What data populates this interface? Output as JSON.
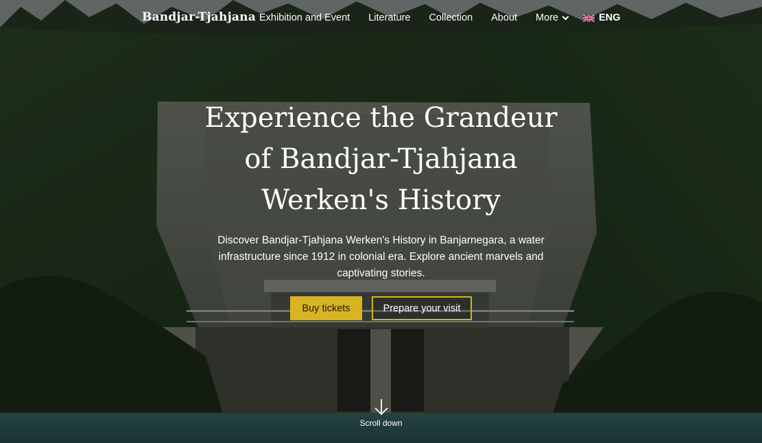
{
  "brand": "Bandjar-Tjahjana",
  "nav": {
    "links": [
      "Exhibition and Event",
      "Literature",
      "Collection",
      "About"
    ],
    "more": "More",
    "lang": "ENG"
  },
  "hero": {
    "title_lines": [
      "Experience the Grandeur",
      "of Bandjar-Tjahjana",
      "Werken's History"
    ],
    "description": "Discover Bandjar-Tjahjana Werken's History in Banjarnegara, a water infrastructure since 1912 in colonial era. Explore ancient marvels and captivating stories.",
    "primary_button": "Buy tickets",
    "secondary_button": "Prepare your visit"
  },
  "scroll": {
    "label": "Scroll down"
  },
  "colors": {
    "accent": "#d8b421",
    "text": "#ffffff"
  },
  "icons": {
    "more": "chevron-down-icon",
    "lang": "uk-flag-icon",
    "scroll": "arrow-down-icon"
  }
}
